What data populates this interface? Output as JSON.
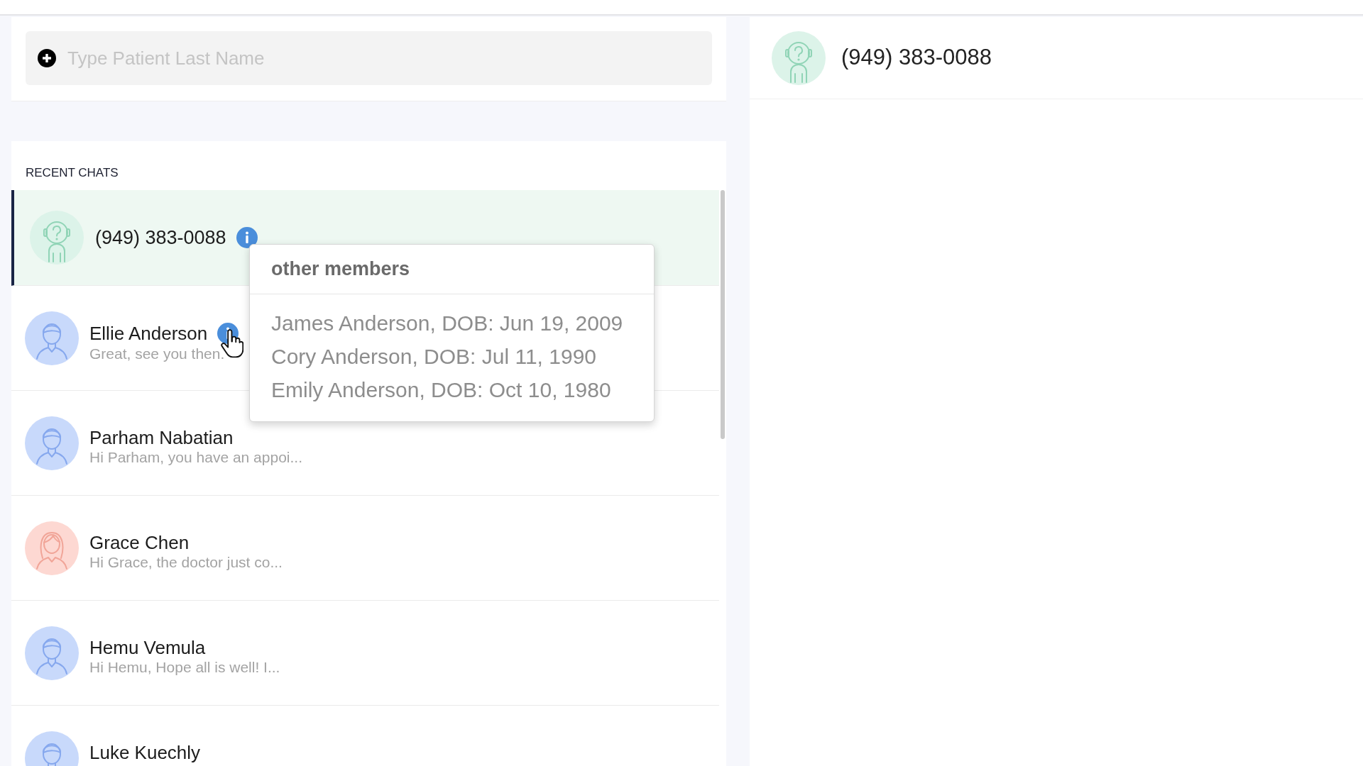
{
  "search": {
    "placeholder": "Type Patient Last Name"
  },
  "recent_chats": {
    "title": "RECENT CHATS",
    "items": [
      {
        "name": "(949) 383-0088",
        "kind": "unknown",
        "selected": true,
        "info_icon": true,
        "cursor": false
      },
      {
        "name": "Ellie Anderson",
        "preview": "Great, see you then.",
        "kind": "male",
        "selected": false,
        "info_icon": true,
        "cursor": true
      },
      {
        "name": "Parham Nabatian",
        "preview": "Hi Parham, you have an appoi...",
        "kind": "male",
        "selected": false,
        "info_icon": false,
        "cursor": false
      },
      {
        "name": "Grace Chen",
        "preview": "Hi Grace, the doctor just co...",
        "kind": "female",
        "selected": false,
        "info_icon": false,
        "cursor": false
      },
      {
        "name": "Hemu Vemula",
        "preview": "Hi Hemu, Hope all is well! I...",
        "kind": "male",
        "selected": false,
        "info_icon": false,
        "cursor": false
      },
      {
        "name": "Luke Kuechly",
        "kind": "male",
        "selected": false,
        "info_icon": false,
        "cursor": false
      }
    ]
  },
  "members_popover": {
    "title": "other members",
    "lines": [
      "James Anderson, DOB: Jun 19, 2009",
      "Cory Anderson, DOB: Jul 11, 1990",
      "Emily Anderson, DOB: Oct 10, 1980"
    ]
  },
  "conversation": {
    "contact": {
      "name": "(949) 383-0088",
      "kind": "unknown"
    }
  }
}
